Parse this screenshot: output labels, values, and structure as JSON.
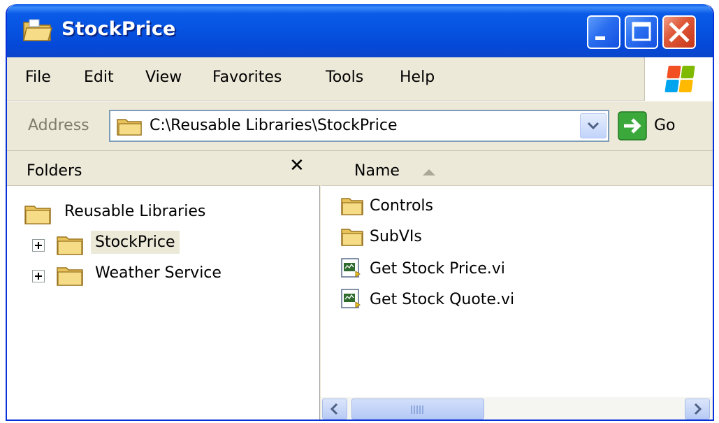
{
  "window": {
    "title": "StockPrice",
    "colors": {
      "titlebar": "#0653e0",
      "frame": "#ece9d8",
      "close": "#e05a3a"
    }
  },
  "menu": {
    "items": [
      "File",
      "Edit",
      "View",
      "Favorites",
      "Tools",
      "Help"
    ]
  },
  "address": {
    "label": "Address",
    "value": "C:\\Reusable Libraries\\StockPrice",
    "go_label": "Go"
  },
  "folders": {
    "title": "Folders",
    "close_symbol": "✕",
    "tree": [
      {
        "label": "Reusable Libraries",
        "expander": false,
        "selected": false
      },
      {
        "label": "StockPrice",
        "expander": true,
        "selected": true
      },
      {
        "label": "Weather Service",
        "expander": true,
        "selected": false
      }
    ]
  },
  "files": {
    "column": "Name",
    "items": [
      {
        "label": "Controls",
        "icon": "folder-icon"
      },
      {
        "label": "SubVIs",
        "icon": "folder-icon"
      },
      {
        "label": "Get Stock Price.vi",
        "icon": "vi-file-icon"
      },
      {
        "label": "Get Stock Quote.vi",
        "icon": "vi-file-icon"
      }
    ]
  }
}
